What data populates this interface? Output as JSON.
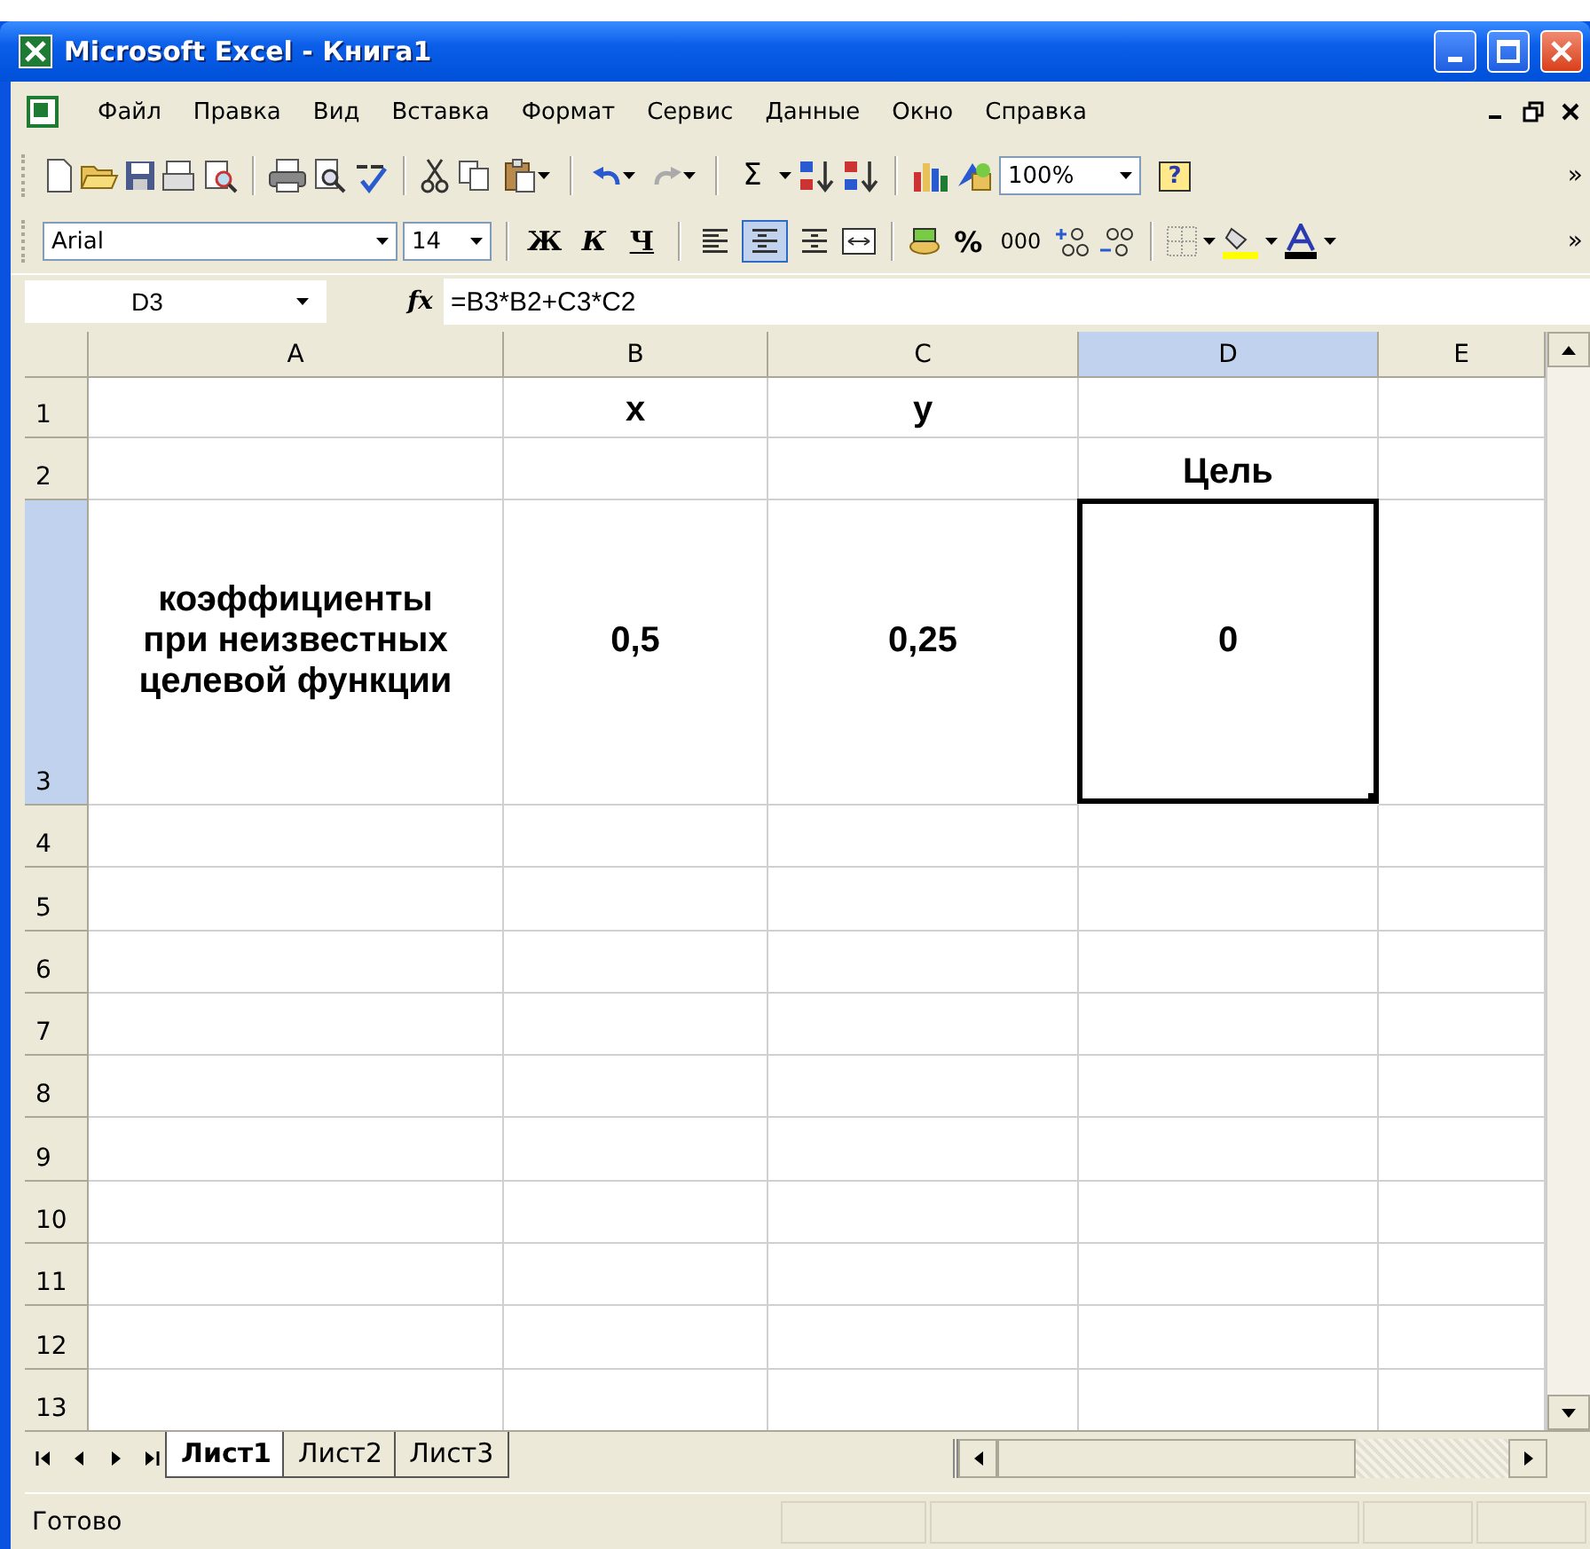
{
  "window": {
    "title": "Microsoft Excel - Книга1"
  },
  "menu": [
    "Файл",
    "Правка",
    "Вид",
    "Вставка",
    "Формат",
    "Сервис",
    "Данные",
    "Окно",
    "Справка"
  ],
  "standard_toolbar": {
    "sum": "Σ",
    "zoom": "100%",
    "help": "?",
    "more": "»"
  },
  "format_toolbar": {
    "font": "Arial",
    "size": "14",
    "bold": "Ж",
    "italic": "К",
    "underline": "Ч",
    "align": [
      {
        "selected": false
      },
      {
        "selected": true
      },
      {
        "selected": false
      }
    ],
    "percent": "%",
    "thousands": "000",
    "more": "»"
  },
  "formula_bar": {
    "name_box": "D3",
    "fx": "fx",
    "formula": "=B3*B2+C3*C2"
  },
  "sheet": {
    "columns": [
      {
        "label": "A",
        "selected": false
      },
      {
        "label": "B",
        "selected": false
      },
      {
        "label": "C",
        "selected": false
      },
      {
        "label": "D",
        "selected": true
      },
      {
        "label": "E",
        "selected": false
      }
    ],
    "rows": [
      {
        "label": "1",
        "selected": false,
        "cells": [
          {
            "active": false
          },
          {
            "text": "x",
            "active": false
          },
          {
            "text": "y",
            "active": false
          },
          {
            "active": false
          },
          {
            "active": false
          }
        ]
      },
      {
        "label": "2",
        "selected": false,
        "cells": [
          {
            "active": false
          },
          {
            "active": false
          },
          {
            "active": false
          },
          {
            "text": "Цель",
            "active": false
          },
          {
            "active": false
          }
        ]
      },
      {
        "label": "3",
        "selected": true,
        "cells": [
          {
            "text": "коэффициенты при неизвестных целевой функции",
            "active": false
          },
          {
            "text": "0,5",
            "active": false
          },
          {
            "text": "0,25",
            "active": false
          },
          {
            "text": "0",
            "active": true
          },
          {
            "active": false
          }
        ]
      },
      {
        "label": "4",
        "selected": false
      },
      {
        "label": "5",
        "selected": false
      },
      {
        "label": "6",
        "selected": false
      },
      {
        "label": "7",
        "selected": false
      },
      {
        "label": "8",
        "selected": false
      },
      {
        "label": "9",
        "selected": false
      },
      {
        "label": "10",
        "selected": false
      },
      {
        "label": "11",
        "selected": false
      },
      {
        "label": "12",
        "selected": false
      },
      {
        "label": "13",
        "selected": false
      }
    ]
  },
  "sheet_tabs": [
    {
      "label": "Лист1",
      "selected": true
    },
    {
      "label": "Лист2",
      "selected": false
    },
    {
      "label": "Лист3",
      "selected": false
    }
  ],
  "status_bar": {
    "text": "Готово"
  }
}
